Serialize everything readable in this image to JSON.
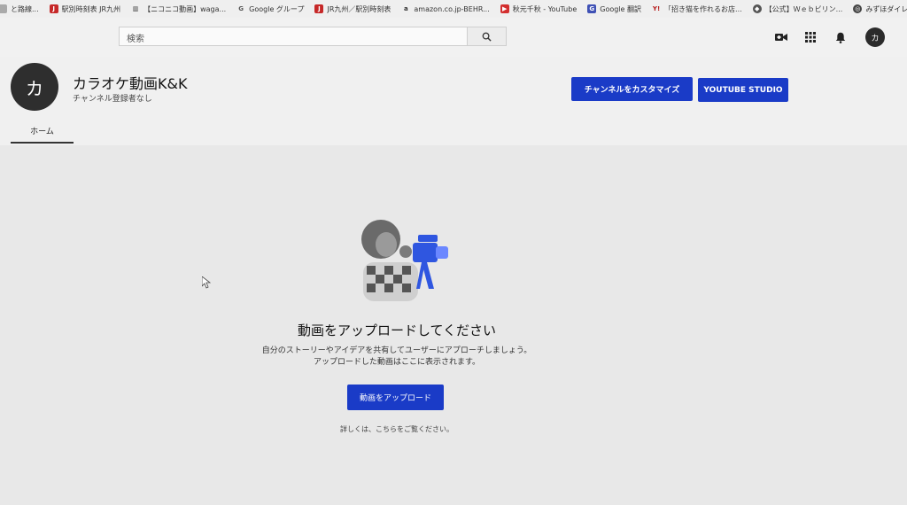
{
  "bookmarks": [
    {
      "label": "と路線...",
      "icon": "doc-icon",
      "color": "#888888"
    },
    {
      "label": "駅別時刻表 JR九州",
      "icon": "jr-icon",
      "color": "#c62828"
    },
    {
      "label": "【ニコニコ動画】waga...",
      "icon": "chart-icon",
      "color": "#555555"
    },
    {
      "label": "Google グループ",
      "icon": "google-icon",
      "color": "#666666"
    },
    {
      "label": "JR九州／駅別時刻表",
      "icon": "jr-icon",
      "color": "#c62828"
    },
    {
      "label": "amazon.co.jp-BEHR...",
      "icon": "amazon-icon",
      "color": "#444444"
    },
    {
      "label": "秋元千秋 - YouTube",
      "icon": "youtube-icon",
      "color": "#d32f2f"
    },
    {
      "label": "Google 翻訳",
      "icon": "translate-icon",
      "color": "#3f51b5"
    },
    {
      "label": "「招き猫を作れるお店...",
      "icon": "yahoo-icon",
      "color": "#b71c1c"
    },
    {
      "label": "【公式】Ｗｅｂビリン...",
      "icon": "web-icon",
      "color": "#555555"
    },
    {
      "label": "みずほダイレクト",
      "icon": "globe-icon",
      "color": "#555555"
    }
  ],
  "search": {
    "placeholder": "検索"
  },
  "user": {
    "avatar_letter": "カ"
  },
  "channel": {
    "avatar_letter": "カ",
    "name": "カラオケ動画K&K",
    "subscribers": "チャンネル登録者なし",
    "customize_label": "チャンネルをカスタマイズ",
    "studio_label": "YOUTUBE STUDIO",
    "tabs": [
      {
        "label": "ホーム",
        "active": true
      }
    ]
  },
  "empty_state": {
    "title": "動画をアップロードしてください",
    "description_line1": "自分のストーリーやアイデアを共有してユーザーにアプローチしましょう。",
    "description_line2": "アップロードした動画はここに表示されます。",
    "upload_label": "動画をアップロード",
    "learn_more": "詳しくは、こちらをご覧ください。"
  },
  "colors": {
    "accent": "#1a3bc7",
    "background": "#e8e8e8"
  }
}
